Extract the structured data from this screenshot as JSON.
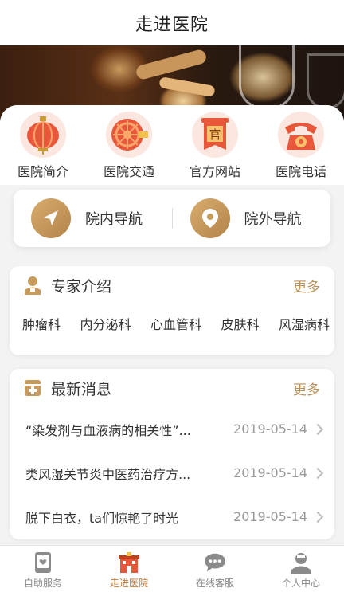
{
  "header": {
    "title": "走进医院"
  },
  "quick_links": [
    {
      "label": "医院简介",
      "icon": "lantern-icon"
    },
    {
      "label": "医院交通",
      "icon": "wheel-icon"
    },
    {
      "label": "官方网站",
      "icon": "official-banner-icon"
    },
    {
      "label": "医院电话",
      "icon": "telephone-icon"
    }
  ],
  "official_icon_char": "官",
  "navigation": {
    "inside": "院内导航",
    "outside": "院外导航"
  },
  "experts": {
    "title": "专家介绍",
    "more": "更多",
    "departments": [
      "肿瘤科",
      "内分泌科",
      "心血管科",
      "皮肤科",
      "风湿病科"
    ]
  },
  "news": {
    "title": "最新消息",
    "more": "更多",
    "items": [
      {
        "title": "“染发剂与血液病的相关性”...",
        "date": "2019-05-14"
      },
      {
        "title": "类风湿关节炎中医药治疗方...",
        "date": "2019-05-14"
      },
      {
        "title": "脱下白衣，ta们惊艳了时光",
        "date": "2019-05-14"
      }
    ]
  },
  "tabs": [
    {
      "label": "自助服务",
      "icon": "tablet-heart-icon",
      "active": false
    },
    {
      "label": "走进医院",
      "icon": "hospital-building-icon",
      "active": true
    },
    {
      "label": "在线客服",
      "icon": "chat-bubble-icon",
      "active": false
    },
    {
      "label": "个人中心",
      "icon": "person-icon",
      "active": false
    }
  ],
  "colors": {
    "accent": "#b8925b",
    "active_tab": "#c07a3a",
    "icon_red": "#e8573a"
  }
}
